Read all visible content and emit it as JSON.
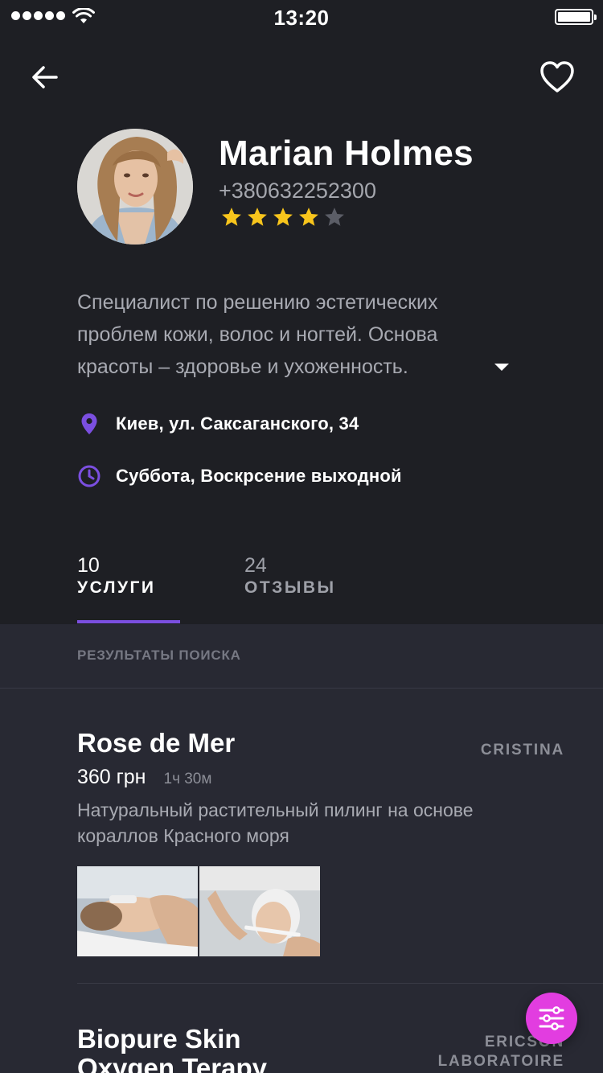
{
  "status_bar": {
    "time": "13:20"
  },
  "profile": {
    "name": "Marian Holmes",
    "phone": "+380632252300",
    "rating": 4,
    "rating_max": 5,
    "description": "Специалист по решению эстетических проблем кожи, волос и ногтей. Основа красоты – здоровье и ухоженность.",
    "address": "Киев, ул. Саксаганского, 34",
    "schedule": "Суббота, Воскрсение выходной"
  },
  "tabs": [
    {
      "count": "10",
      "label": "УСЛУГИ",
      "active": true
    },
    {
      "count": "24",
      "label": "ОТЗЫВЫ",
      "active": false
    }
  ],
  "results": {
    "title": "РЕЗУЛЬТАТЫ ПОИСКА",
    "items": [
      {
        "title": "Rose de Mer",
        "provider": "CRISTINA",
        "price": "360 грн",
        "duration": "1ч 30м",
        "description": "Натуральный растительный пилинг на основе кораллов Красного моря"
      },
      {
        "title": "Biopure Skin Oxygen Terapy",
        "provider": "ERICSON LABORATOIRE"
      }
    ]
  },
  "colors": {
    "background": "#1e1f24",
    "list_background": "#282933",
    "accent": "#7b4fe0",
    "star": "#f8c51c",
    "fab": "#e23de0"
  },
  "icons": {
    "back": "arrow-left-icon",
    "favorite": "heart-outline-icon",
    "location": "map-pin-icon",
    "schedule": "clock-icon",
    "expand": "caret-down-icon",
    "filter": "sliders-icon"
  }
}
